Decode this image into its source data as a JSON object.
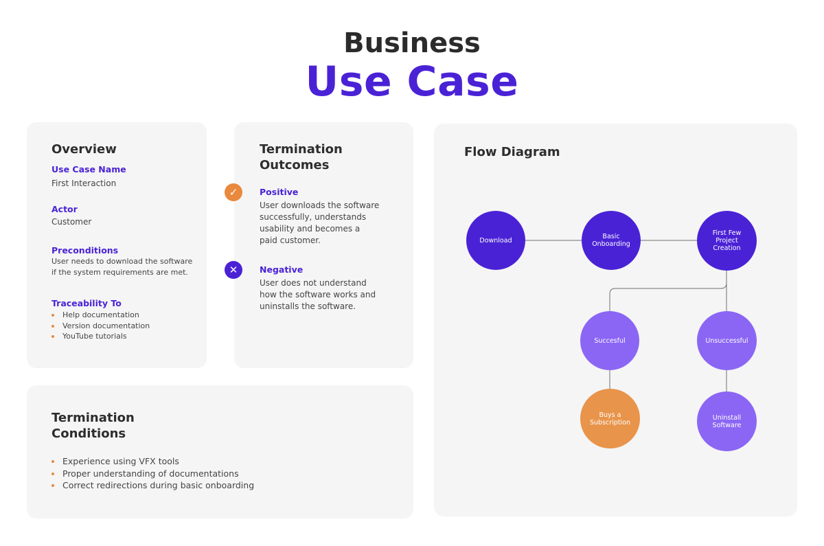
{
  "header": {
    "line1": "Business",
    "line2": "Use Case"
  },
  "overview": {
    "title": "Overview",
    "use_case_name_label": "Use Case Name",
    "use_case_name_value": "First Interaction",
    "actor_label": "Actor",
    "actor_value": "Customer",
    "preconditions_label": "Preconditions",
    "preconditions_line1": "User needs to download the software",
    "preconditions_line2": "if the system requirements are met.",
    "traceability_label": "Traceability To",
    "traceability_items": [
      "Help documentation",
      "Version documentation",
      "YouTube tutorials"
    ]
  },
  "outcomes": {
    "title_line1": "Termination",
    "title_line2": "Outcomes",
    "positive_label": "Positive",
    "positive_lines": [
      "User downloads the software",
      "successfully, understands",
      "usability and becomes a",
      "paid customer."
    ],
    "negative_label": "Negative",
    "negative_lines": [
      "User does not understand",
      "how the software works and",
      "uninstalls the software."
    ],
    "positive_icon": "check-icon",
    "negative_icon": "x-icon",
    "positive_color": "#e8893d",
    "negative_color": "#4a22d6"
  },
  "conditions": {
    "title_line1": "Termination",
    "title_line2": "Conditions",
    "items": [
      "Experience using VFX tools",
      "Proper understanding of documentations",
      "Correct redirections during basic onboarding"
    ]
  },
  "flow": {
    "title": "Flow Diagram",
    "nodes": {
      "download": "Download",
      "basic_onboarding": [
        "Basic",
        "Onboarding"
      ],
      "first_few": [
        "First Few",
        "Project",
        "Creation"
      ],
      "successful": "Succesful",
      "unsuccessful": "Unsuccessful",
      "buys": [
        "Buys a",
        "Subscription"
      ],
      "uninstall": [
        "Uninstall",
        "Software"
      ]
    }
  },
  "colors": {
    "accent_purple": "#4a22d6",
    "light_purple": "#8b66f4",
    "orange": "#e8944a",
    "card_bg": "#f5f5f5"
  }
}
